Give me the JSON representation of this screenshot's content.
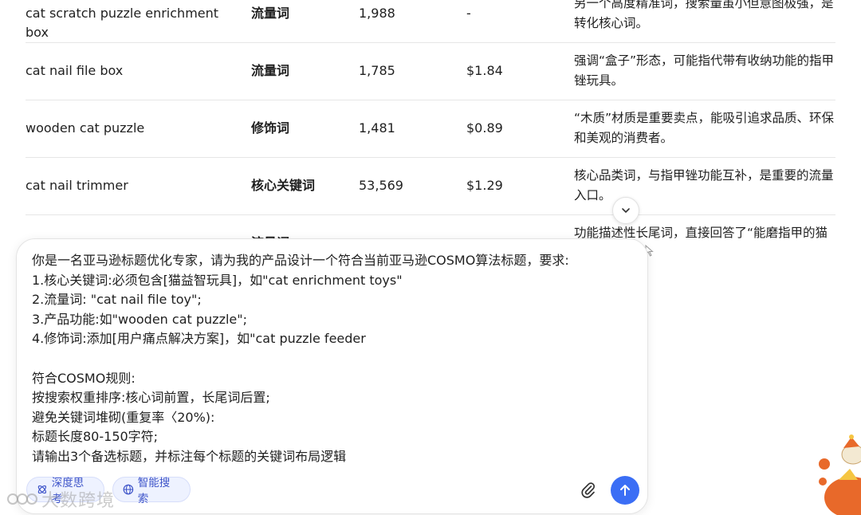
{
  "table": {
    "rows": [
      {
        "keyword": "cat scratch puzzle enrichment box",
        "type": "流量词",
        "volume": "1,988",
        "price": "-",
        "note_line1": "另一个高度精准词，搜索量虽小但意图极强，是",
        "note_line2": "转化核心词。"
      },
      {
        "keyword": "cat nail file box",
        "type": "流量词",
        "volume": "1,785",
        "price": "$1.84",
        "note_line1": "强调“盒子”形态，可能指代带有收纳功能的指甲",
        "note_line2": "锉玩具。"
      },
      {
        "keyword": "wooden cat puzzle",
        "type": "修饰词",
        "volume": "1,481",
        "price": "$0.89",
        "note_line1": "“木质”材质是重要卖点，能吸引追求品质、环保",
        "note_line2": "和美观的消费者。"
      },
      {
        "keyword": "cat nail trimmer",
        "type": "核心关键词",
        "volume": "53,569",
        "price": "$1.29",
        "note_line1": "核心品类词，与指甲锉功能互补，是重要的流量",
        "note_line2": "入口。"
      },
      {
        "keyword": "",
        "type": "流量词",
        "volume": "",
        "price": "",
        "note_line1": "功能描述性长尾词，直接回答了“能磨指甲的猫",
        "note_line2": ""
      }
    ]
  },
  "composer": {
    "prompt_text": "你是一名亚马逊标题优化专家，请为我的产品设计一个符合当前亚马逊COSMO算法标题，要求:\n1.核心关键词:必须包含[猫益智玩具]，如\"cat enrichment toys\"\n2.流量词: \"cat nail file toy\";\n3.产品功能:如\"wooden cat puzzle\";\n4.修饰词:添加[用户痛点解决方案]，如\"cat puzzle feeder\n\n符合COSMO规则:\n按搜索权重排序:核心词前置，长尾词后置;\n避免关键词堆砌(重复率〈20%):\n标题长度80-150字符;\n请输出3个备选标题，并标注每个标题的关键词布局逻辑",
    "deep_think_label": "深度思考",
    "smart_search_label": "智能搜索"
  },
  "watermark_text": "大数跨境",
  "colors": {
    "accent": "#3b6ef5",
    "chip_bg": "#eef2ff",
    "chip_text": "#3f55c9"
  },
  "icons": [
    "chevron-down-icon",
    "deep-think-icon",
    "globe-icon",
    "paperclip-icon",
    "arrow-up-icon"
  ]
}
